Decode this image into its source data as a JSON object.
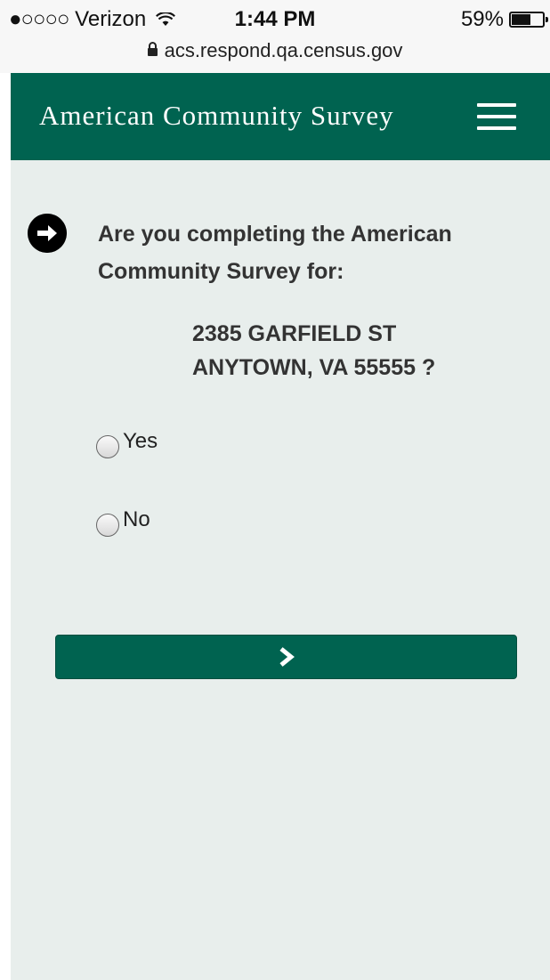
{
  "status_bar": {
    "signal": "●○○○○",
    "carrier": "Verizon",
    "wifi_icon": "wifi-icon",
    "time": "1:44 PM",
    "battery_percent": "59%",
    "battery_level": 0.59
  },
  "url_bar": {
    "lock_icon": "lock-icon",
    "url": "acs.respond.qa.census.gov"
  },
  "header": {
    "title": "American Community Survey",
    "menu_icon": "hamburger-menu-icon"
  },
  "question": {
    "icon": "arrow-right-circle-icon",
    "text": "Are you completing the American Community Survey for:",
    "address_line1": "2385 GARFIELD ST",
    "address_line2": "ANYTOWN, VA 55555 ?"
  },
  "options": [
    {
      "label": "Yes",
      "selected": false
    },
    {
      "label": "No",
      "selected": false
    }
  ],
  "next_button": {
    "icon": "chevron-right-icon"
  },
  "colors": {
    "brand_green": "#006350",
    "page_bg": "#e8eeec"
  }
}
